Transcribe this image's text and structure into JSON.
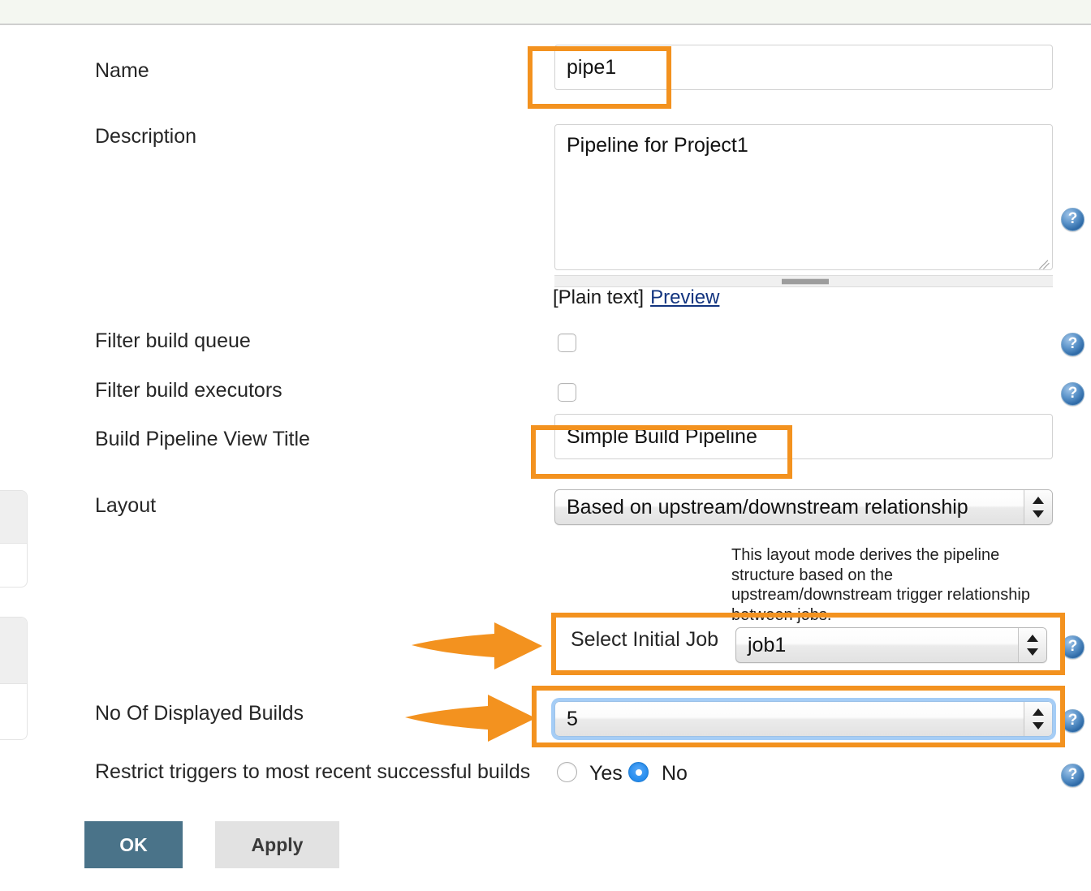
{
  "window": {
    "header_band": "",
    "accent_color": "#f3921f",
    "link_color": "#12347f",
    "ok_button_color": "#4a7389"
  },
  "form": {
    "fields": [
      {
        "label": "Name",
        "value": "pipe1",
        "type": "text"
      },
      {
        "label": "Description",
        "value": "Pipeline for Project1",
        "type": "textarea"
      },
      {
        "label": "Filter build queue",
        "value": "",
        "type": "checkbox"
      },
      {
        "label": "Filter build executors",
        "value": "",
        "type": "checkbox"
      },
      {
        "label": "Build Pipeline View Title",
        "value": "Simple Build Pipeline",
        "type": "text"
      },
      {
        "label": "Layout",
        "value": "Based on upstream/downstream relationship",
        "type": "select"
      },
      {
        "label": "Select Initial Job",
        "value": "job1",
        "type": "select"
      },
      {
        "label": "No Of Displayed Builds",
        "value": "5",
        "type": "select"
      },
      {
        "label": "Restrict triggers to most recent successful builds",
        "value": "No",
        "type": "radio"
      }
    ],
    "description_markup_label": "[Plain text]",
    "description_preview_link": "Preview",
    "layout_help_text": "This layout mode derives the pipeline structure based on the upstream/downstream trigger relationship between jobs.",
    "radio_options": [
      {
        "label": "Yes",
        "selected": false
      },
      {
        "label": "No",
        "selected": true
      }
    ],
    "help_icon_glyph": "?"
  },
  "buttons": {
    "ok": "OK",
    "apply": "Apply"
  },
  "annotations": {
    "boxes": [
      {
        "target": "name-input"
      },
      {
        "target": "build-pipeline-view-title-input"
      },
      {
        "target": "select-initial-job-row"
      },
      {
        "target": "no-of-displayed-builds-select"
      }
    ],
    "arrows": [
      {
        "target": "select-initial-job-row"
      },
      {
        "target": "no-of-displayed-builds-select"
      }
    ]
  }
}
